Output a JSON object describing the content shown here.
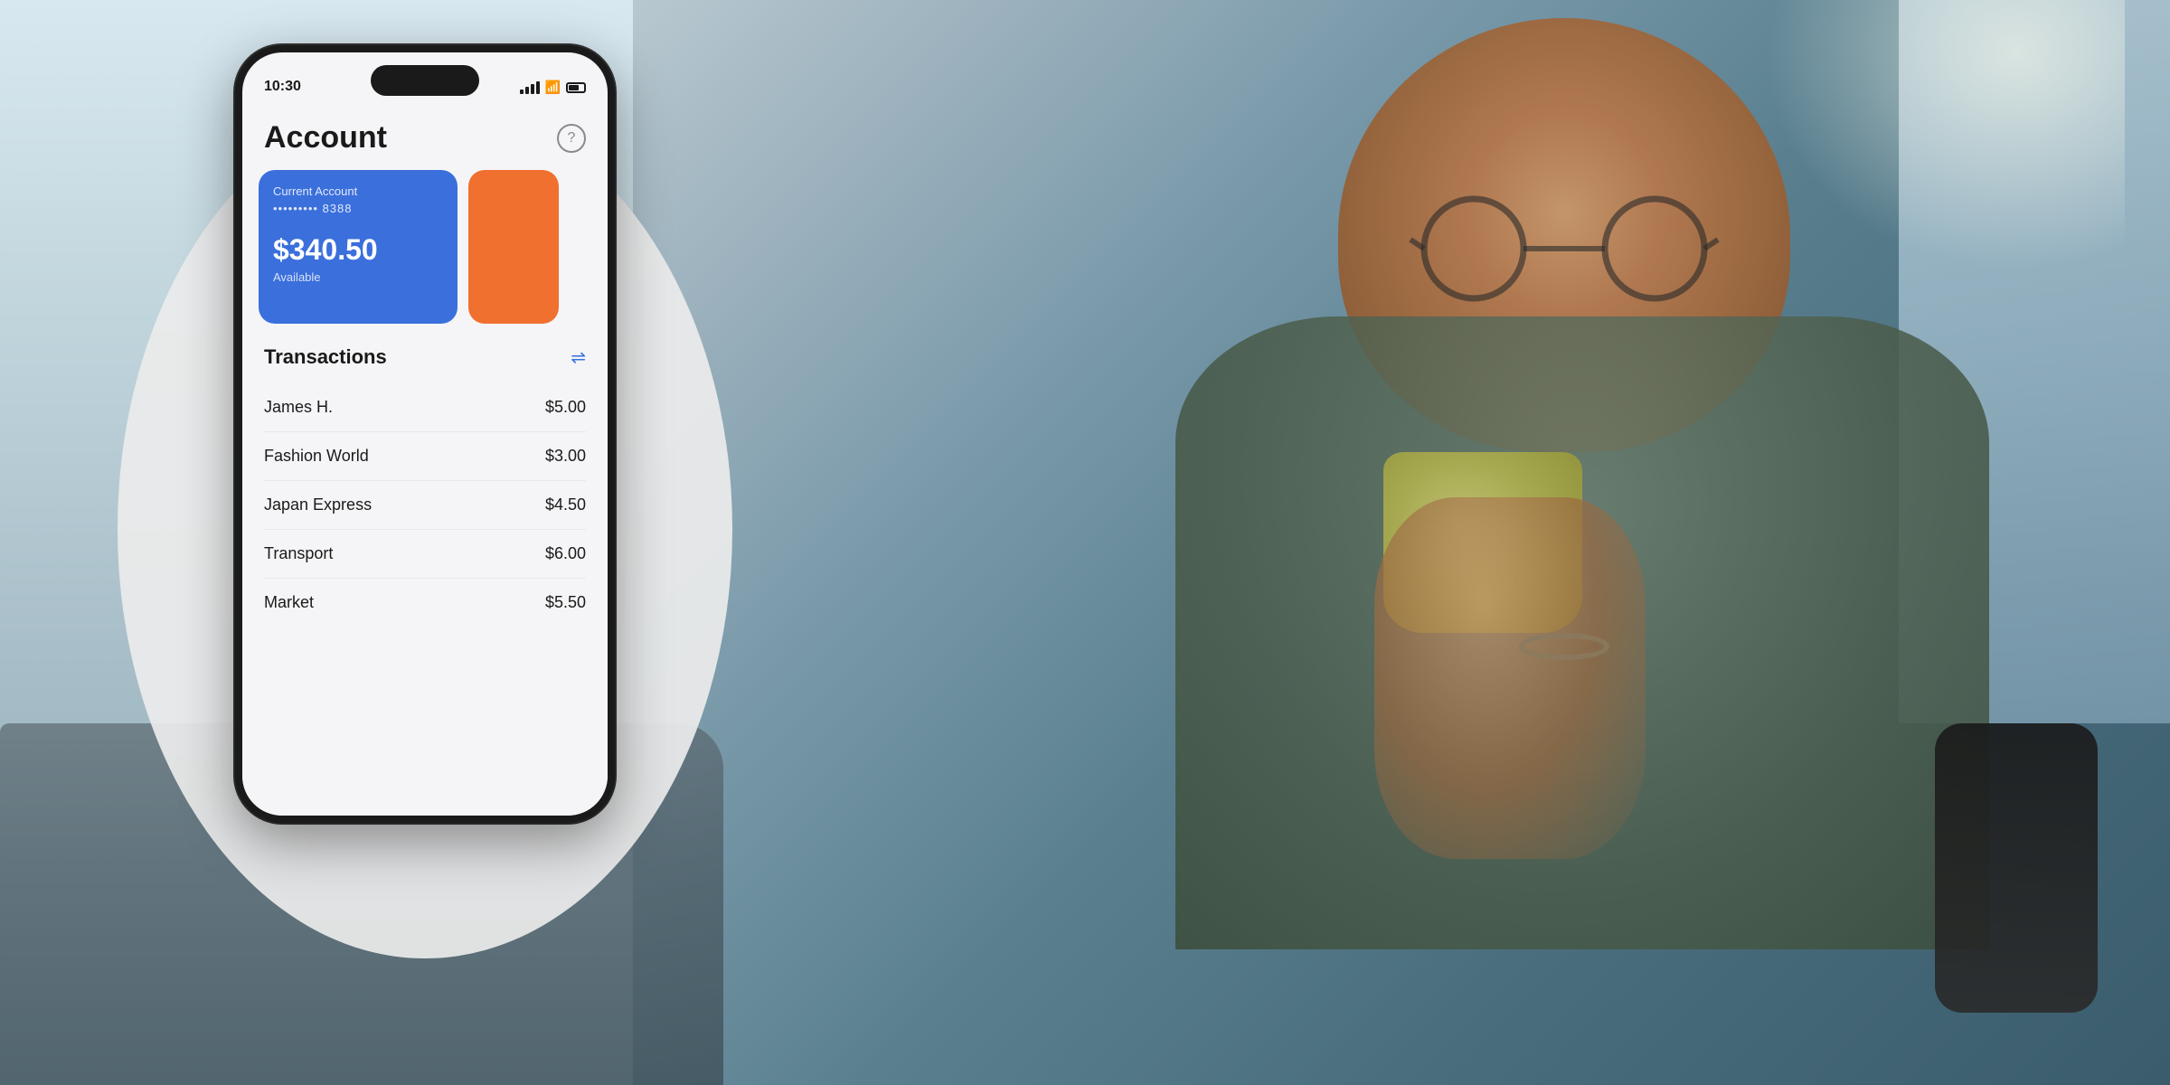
{
  "background": {
    "description": "Man sitting on couch drinking coffee while looking at phone"
  },
  "phone": {
    "status_bar": {
      "time": "10:30",
      "signal_label": "signal-icon",
      "wifi_label": "wifi-icon",
      "battery_label": "battery-icon"
    },
    "page": {
      "title": "Account",
      "help_label": "?"
    },
    "account_card": {
      "label": "Current Account",
      "number": "••••••••• 8388",
      "balance": "$340.50",
      "available": "Available"
    },
    "transactions": {
      "title": "Transactions",
      "icon": "⇌",
      "items": [
        {
          "name": "James H.",
          "amount": "$5.00"
        },
        {
          "name": "Fashion World",
          "amount": "$3.00"
        },
        {
          "name": "Japan Express",
          "amount": "$4.50"
        },
        {
          "name": "Transport",
          "amount": "$6.00"
        },
        {
          "name": "Market",
          "amount": "$5.50"
        }
      ]
    }
  },
  "colors": {
    "card_blue": "#3a6fdc",
    "card_orange": "#f07030",
    "background_light": "#f5f5f7",
    "text_primary": "#1a1a1a"
  }
}
